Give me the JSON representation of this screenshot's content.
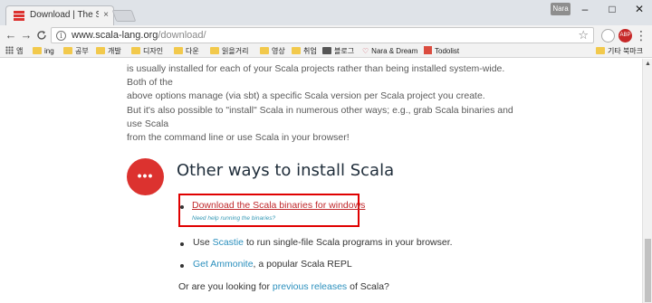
{
  "browser": {
    "tab_title": "Download | The Scala P",
    "tab_close": "×",
    "user_badge": "Nara",
    "minimize": "–",
    "maximize": "□",
    "close": "✕",
    "back": "←",
    "forward": "→",
    "reload": "C",
    "url_host": "www.scala-lang.org",
    "url_path": "/download/",
    "ext_badge": "ABP",
    "menu": "⋮"
  },
  "bookmarks": {
    "apps": "앱",
    "items": [
      "ing",
      "공부",
      "개발",
      "디자인",
      "다운",
      "읽을거리",
      "영상",
      "취업",
      "블로그",
      "Nara & Dream",
      "Todolist"
    ],
    "other": "기타 북마크"
  },
  "page": {
    "para1_line1": "is usually installed for each of your Scala projects rather than being installed system-wide. Both of the",
    "para1_line2": "above options manage (via sbt) a specific Scala version per Scala project you create.",
    "para2_line1": "But it's also possible to \"install\" Scala in numerous other ways; e.g., grab Scala binaries and use Scala",
    "para2_line2": "from the command line or use Scala in your browser!",
    "section_icon_glyph": "•••",
    "section_title": "Other ways to install Scala",
    "download_link": "Download the Scala binaries for windows",
    "download_help": "Need help running the binaries?",
    "scastie_pre": "Use ",
    "scastie_link": "Scastie",
    "scastie_post": " to run single-file Scala programs in your browser.",
    "ammonite_link": "Get Ammonite",
    "ammonite_post": ", a popular Scala REPL",
    "footer_pre": "Or are you looking for ",
    "footer_link": "previous releases",
    "footer_post": " of Scala?"
  },
  "colors": {
    "accent_red": "#dc322f",
    "link_blue": "#2a8fbd",
    "highlight": "#e00000"
  }
}
